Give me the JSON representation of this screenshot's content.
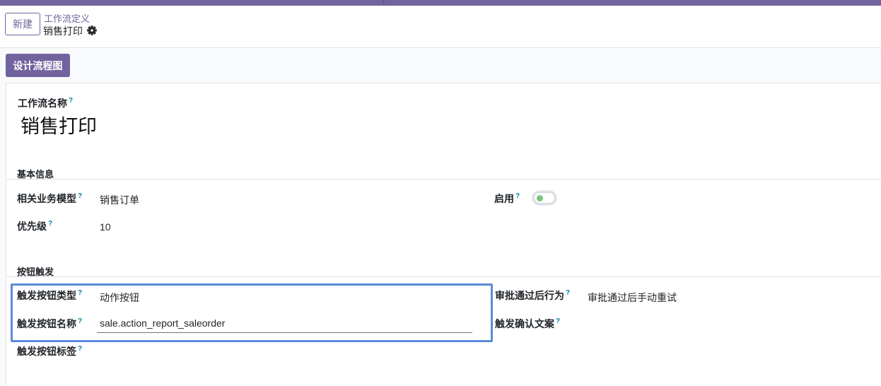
{
  "header": {
    "new_button": "新建",
    "breadcrumb_parent": "工作流定义",
    "breadcrumb_current": "销售打印"
  },
  "toolbar": {
    "design_button": "设计流程图"
  },
  "form": {
    "name_label": "工作流名称",
    "name_value": "销售打印",
    "help_mark": "?",
    "basic_section": "基本信息",
    "model_label": "相关业务模型",
    "model_value": "销售订单",
    "active_label": "启用",
    "active_value": true,
    "priority_label": "优先级",
    "priority_value": "10",
    "button_section": "按钮触发",
    "trigger_type_label": "触发按钮类型",
    "trigger_type_value": "动作按钮",
    "trigger_name_label": "触发按钮名称",
    "trigger_name_value": "sale.action_report_saleorder",
    "trigger_tag_label": "触发按钮标签",
    "after_approve_label": "审批通过后行为",
    "after_approve_value": "审批通过后手动重试",
    "confirm_text_label": "触发确认文案"
  },
  "colors": {
    "brand": "#71639e",
    "help": "#0180a5",
    "highlight": "#5b8bd9",
    "toggle_knob": "#7bc67e"
  }
}
